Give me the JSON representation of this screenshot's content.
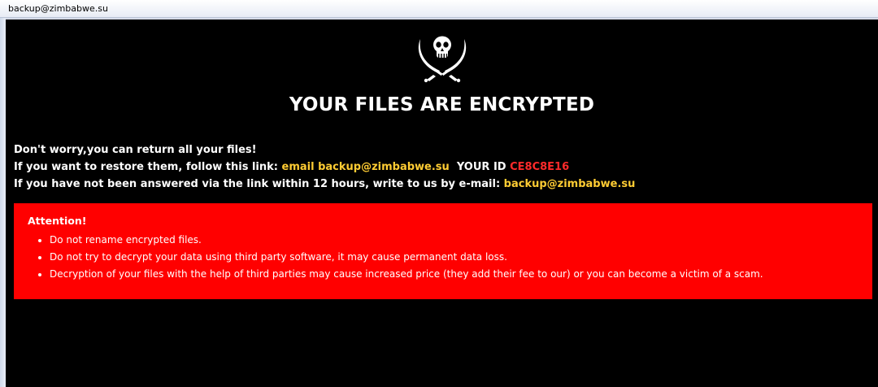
{
  "window": {
    "title": "backup@zimbabwe.su"
  },
  "logo": {
    "icon": "skull-crossed-swords-icon"
  },
  "headline": "YOUR FILES ARE ENCRYPTED",
  "message": {
    "line1": "Don't worry,you can return all your files!",
    "line2_prefix": "If you want to restore them, follow this link: ",
    "line2_link": "email backup@zimbabwe.su",
    "line2_id_label": "  YOUR ID ",
    "line2_id_value": "CE8C8E16",
    "line3_prefix": "If you have not been answered via the link within 12 hours, write to us by e-mail: ",
    "line3_email": "backup@zimbabwe.su"
  },
  "attention": {
    "title": "Attention!",
    "items": [
      "Do not rename encrypted files.",
      "Do not try to decrypt your data using third party software, it may cause permanent data loss.",
      "Decryption of your files with the help of third parties may cause increased price (they add their fee to our) or you can become a victim of a scam."
    ]
  },
  "colors": {
    "background": "#000000",
    "accent_yellow": "#ffcc33",
    "id_red": "#ff2a2a",
    "attention_red": "#ff0000"
  }
}
